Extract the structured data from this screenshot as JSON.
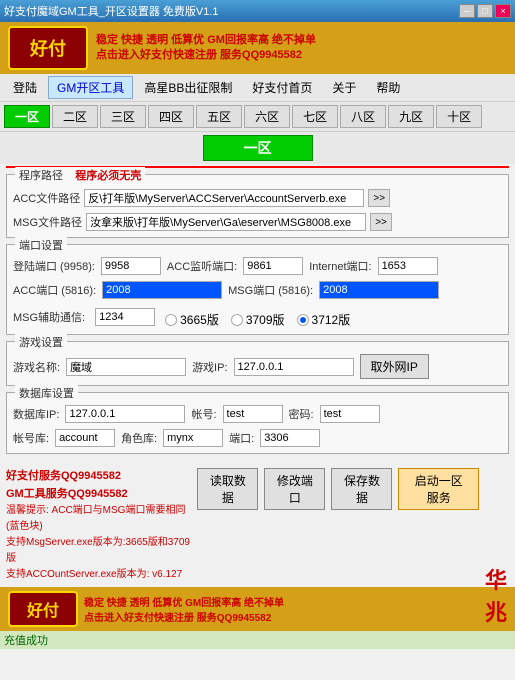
{
  "window": {
    "title": "好支付魔域GM工具_开区设置器 免费版V1.1",
    "minimize": "─",
    "restore": "□",
    "close": "×"
  },
  "banner": {
    "logo": "好付",
    "text_line1": "稳定  快捷  透明  低算优  GM回报率高  绝不掉单",
    "text_line2": "点击进入好支付快速注册   服务QQ9945582",
    "qq": "服务QQ9945582"
  },
  "menu": {
    "items": [
      "登陆",
      "GM开区工具",
      "高星BB出征限制",
      "好支付首页",
      "关于",
      "帮助"
    ],
    "active": "GM开区工具"
  },
  "zones": {
    "buttons": [
      "一区",
      "二区",
      "三区",
      "四区",
      "五区",
      "六区",
      "七区",
      "八区",
      "九区",
      "十区"
    ],
    "active": "一区"
  },
  "zone_title": "一区",
  "path_section": {
    "title": "程序路径",
    "required": "程序必须无壳",
    "acc_label": "ACC文件路径",
    "acc_value": "反\\打年版\\MyServer\\ACCServer\\AccountServerb.exe",
    "msg_label": "MSG文件路径",
    "msg_value": "汝拿来版\\打年版\\MyServer\\Ga\\eserver\\MSG8008.exe"
  },
  "port_section": {
    "title": "端口设置",
    "login_label": "登陆端口 (9958):",
    "login_value": "9958",
    "acc_monitor_label": "ACC监听端口:",
    "acc_monitor_value": "9861",
    "internet_label": "Internet端口:",
    "internet_value": "1653",
    "acc_port_label": "ACC端口 (5816):",
    "acc_port_value": "2008",
    "msg_port_label": "MSG端口 (5816):",
    "msg_port_value": "2008",
    "msg_helper_label": "MSG辅助通信:",
    "msg_helper_value": "1234",
    "radio_options": [
      "3665版",
      "3709版",
      "3712版"
    ],
    "radio_active": "3712版"
  },
  "game_section": {
    "title": "游戏设置",
    "name_label": "游戏名称:",
    "name_value": "魔域",
    "ip_label": "游戏IP:",
    "ip_value": "127.0.0.1",
    "get_ip_btn": "取外网IP"
  },
  "db_section": {
    "title": "数据库设置",
    "db_label": "数据库IP:",
    "db_value": "127.0.0.1",
    "account_label": "帐号:",
    "account_value": "test",
    "password_label": "密码:",
    "password_value": "test",
    "account2_label": "帐号库:",
    "account2_value": "account",
    "role_label": "角色库:",
    "role_value": "mynx",
    "port_label": "端口:",
    "port_value": "3306"
  },
  "bottom": {
    "service_qq": "好支付服务QQ9945582",
    "gm_qq": "GM工具服务QQ9945582",
    "warning1": "温馨提示: ACC端口与MSG端口需要相同 (蓝色块)",
    "warning2": "支持MsgServer.exe版本为:3665版和3709版",
    "warning3": "支持ACCOuntServer.exe版本为: v6.127",
    "btn_read": "读取数据",
    "btn_modify": "修改端口",
    "btn_save": "保存数据",
    "btn_start": "启动一区服务",
    "hua": "华\n兆"
  },
  "status": "充值成功"
}
